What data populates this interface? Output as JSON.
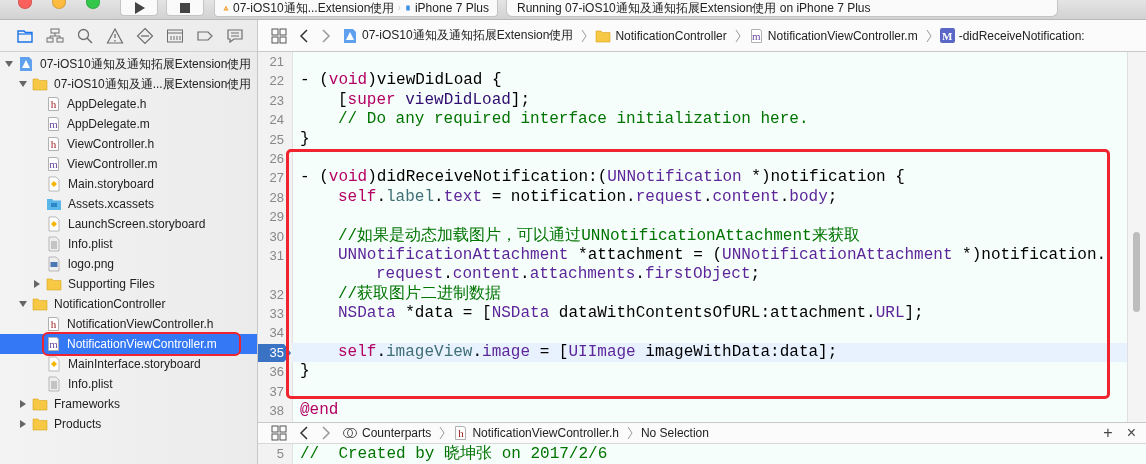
{
  "toolbar": {
    "scheme": "07-iOS10通知...Extension使用",
    "device": "iPhone 7 Plus",
    "status": "Running 07-iOS10通知及通知拓展Extension使用 on iPhone 7 Plus"
  },
  "navigator_tabs": [
    {
      "kind": "folder",
      "selected": true
    },
    {
      "kind": "hierarchy",
      "selected": false
    },
    {
      "kind": "search",
      "selected": false
    },
    {
      "kind": "warning",
      "selected": false
    },
    {
      "kind": "test",
      "selected": false
    },
    {
      "kind": "debug",
      "selected": false
    },
    {
      "kind": "breakpoint",
      "selected": false
    },
    {
      "kind": "report",
      "selected": false
    }
  ],
  "tree": [
    {
      "kind": "project",
      "name": "07-iOS10通知及通知拓展Extension使用",
      "expanded": true,
      "selected": false,
      "children": [
        {
          "kind": "folder",
          "name": "07-iOS10通知及通...展Extension使用",
          "expanded": true,
          "selected": false,
          "children": [
            {
              "kind": "header",
              "letter": "h",
              "name": "AppDelegate.h",
              "selected": false
            },
            {
              "kind": "source",
              "letter": "m",
              "name": "AppDelegate.m",
              "selected": false
            },
            {
              "kind": "header",
              "letter": "h",
              "name": "ViewController.h",
              "selected": false
            },
            {
              "kind": "source",
              "letter": "m",
              "name": "ViewController.m",
              "selected": false
            },
            {
              "kind": "storyboard",
              "name": "Main.storyboard",
              "selected": false
            },
            {
              "kind": "assets",
              "name": "Assets.xcassets",
              "selected": false
            },
            {
              "kind": "storyboard",
              "name": "LaunchScreen.storyboard",
              "selected": false
            },
            {
              "kind": "plist",
              "name": "Info.plist",
              "selected": false
            },
            {
              "kind": "image",
              "name": "logo.png",
              "selected": false
            },
            {
              "kind": "folder",
              "name": "Supporting Files",
              "expanded": false,
              "selected": false
            }
          ]
        },
        {
          "kind": "folder",
          "name": "NotificationController",
          "expanded": true,
          "selected": false,
          "children": [
            {
              "kind": "header",
              "letter": "h",
              "name": "NotificationViewController.h",
              "selected": false
            },
            {
              "kind": "source",
              "letter": "m",
              "name": "NotificationViewController.m",
              "selected": true,
              "boxed": true
            },
            {
              "kind": "storyboard",
              "name": "MainInterface.storyboard",
              "selected": false
            },
            {
              "kind": "plist",
              "name": "Info.plist",
              "selected": false
            }
          ]
        },
        {
          "kind": "folder",
          "name": "Frameworks",
          "expanded": false,
          "selected": false
        },
        {
          "kind": "folder",
          "name": "Products",
          "expanded": false,
          "selected": false
        }
      ]
    }
  ],
  "jump_bar": [
    {
      "kind": "project",
      "text": "07-iOS10通知及通知拓展Extension使用"
    },
    {
      "kind": "folder",
      "text": "NotificationController"
    },
    {
      "kind": "source",
      "letter": "m",
      "text": "NotificationViewController.m"
    },
    {
      "kind": "method",
      "letter": "M",
      "text": "-didReceiveNotification:"
    }
  ],
  "editor": {
    "blocks": [
      {
        "lines": [
          {
            "number": "21"
          },
          {
            "number": "22",
            "tokens": [
              {
                "kind": "plain",
                "text": "- ("
              },
              {
                "kind": "keyword",
                "text": "void"
              },
              {
                "kind": "plain",
                "text": ")viewDidLoad {"
              }
            ]
          },
          {
            "number": "23",
            "indented": true,
            "tokens": [
              {
                "kind": "plain",
                "text": "["
              },
              {
                "kind": "keyword",
                "text": "super"
              },
              {
                "kind": "message",
                "text": " viewDidLoad"
              },
              {
                "kind": "plain",
                "text": "];"
              }
            ]
          },
          {
            "number": "24",
            "indented": true,
            "tokens": [
              {
                "kind": "comment",
                "text": "// Do any required interface initialization here."
              }
            ]
          },
          {
            "number": "25",
            "tokens": [
              {
                "kind": "plain",
                "text": "}"
              }
            ]
          }
        ]
      },
      {
        "boxed": true,
        "lines": [
          {
            "number": "26"
          },
          {
            "number": "27",
            "tokens": [
              {
                "kind": "plain",
                "text": "- ("
              },
              {
                "kind": "keyword",
                "text": "void"
              },
              {
                "kind": "plain",
                "text": ")didReceiveNotification:("
              },
              {
                "kind": "class",
                "text": "UNNotification"
              },
              {
                "kind": "plain",
                "text": " *)notification {"
              }
            ]
          },
          {
            "number": "28",
            "indented": true,
            "tokens": [
              {
                "kind": "keyword",
                "text": "self"
              },
              {
                "kind": "plain",
                "text": "."
              },
              {
                "kind": "project",
                "text": "label"
              },
              {
                "kind": "plain",
                "text": "."
              },
              {
                "kind": "property",
                "text": "text"
              },
              {
                "kind": "plain",
                "text": " = notification."
              },
              {
                "kind": "property",
                "text": "request"
              },
              {
                "kind": "plain",
                "text": "."
              },
              {
                "kind": "property",
                "text": "content"
              },
              {
                "kind": "plain",
                "text": "."
              },
              {
                "kind": "property",
                "text": "body"
              },
              {
                "kind": "plain",
                "text": ";"
              }
            ]
          },
          {
            "number": "29"
          },
          {
            "number": "30",
            "indented": true,
            "tokens": [
              {
                "kind": "comment",
                "text": "//如果是动态加载图片，可以通过UNNotificationAttachment来获取"
              }
            ]
          },
          {
            "number": "31",
            "indented": true,
            "tokens": [
              {
                "kind": "class",
                "text": "UNNotificationAttachment"
              },
              {
                "kind": "plain",
                "text": " *attachment = ("
              },
              {
                "kind": "class",
                "text": "UNNotificationAttachment"
              },
              {
                "kind": "plain",
                "text": " *)notification."
              }
            ],
            "continuation": [
              {
                "kind": "property",
                "text": "request"
              },
              {
                "kind": "plain",
                "text": "."
              },
              {
                "kind": "property",
                "text": "content"
              },
              {
                "kind": "plain",
                "text": "."
              },
              {
                "kind": "property",
                "text": "attachments"
              },
              {
                "kind": "plain",
                "text": "."
              },
              {
                "kind": "property",
                "text": "firstObject"
              },
              {
                "kind": "plain",
                "text": ";"
              }
            ]
          },
          {
            "number": "32",
            "indented": true,
            "tokens": [
              {
                "kind": "comment",
                "text": "//获取图片二进制数据"
              }
            ]
          },
          {
            "number": "33",
            "indented": true,
            "tokens": [
              {
                "kind": "class",
                "text": "NSData"
              },
              {
                "kind": "plain",
                "text": " *data = ["
              },
              {
                "kind": "class",
                "text": "NSData"
              },
              {
                "kind": "plain",
                "text": " dataWithContentsOfURL:attachment."
              },
              {
                "kind": "property",
                "text": "URL"
              },
              {
                "kind": "plain",
                "text": "];"
              }
            ]
          },
          {
            "number": "34"
          },
          {
            "number": "35",
            "indented": true,
            "current": true,
            "breakpoint": true,
            "tokens": [
              {
                "kind": "keyword",
                "text": "self"
              },
              {
                "kind": "plain",
                "text": "."
              },
              {
                "kind": "project",
                "text": "imageView"
              },
              {
                "kind": "plain",
                "text": "."
              },
              {
                "kind": "property",
                "text": "image"
              },
              {
                "kind": "plain",
                "text": " = ["
              },
              {
                "kind": "class",
                "text": "UIImage"
              },
              {
                "kind": "plain",
                "text": " imageWithData:data];"
              }
            ]
          },
          {
            "number": "36",
            "tokens": [
              {
                "kind": "plain",
                "text": "}"
              }
            ]
          },
          {
            "number": "37"
          }
        ]
      },
      {
        "lines": [
          {
            "number": "38",
            "tokens": [
              {
                "kind": "keyword",
                "text": "@end"
              }
            ]
          }
        ]
      }
    ]
  },
  "assistant": {
    "jump_bar": [
      {
        "kind": "counterparts",
        "text": "Counterparts"
      },
      {
        "kind": "header",
        "letter": "h",
        "text": "NotificationViewController.h"
      },
      {
        "kind": "plain",
        "text": "No Selection"
      }
    ],
    "add_label": "+",
    "close_label": "×",
    "lines": [
      {
        "number": "5",
        "tokens": [
          {
            "kind": "comment",
            "text": "//  Created by 晓坤张 on 2017/2/6"
          }
        ]
      }
    ]
  }
}
